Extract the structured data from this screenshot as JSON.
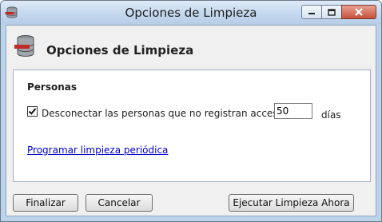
{
  "window": {
    "title": "Opciones de Limpieza"
  },
  "header": {
    "title": "Opciones de Limpieza",
    "icon": "database-cleanup-icon"
  },
  "section": {
    "title": "Personas",
    "checkbox_label": "Desconectar las personas que no registran acceso:",
    "checkbox_checked": true,
    "days_value": "50",
    "days_unit": "días",
    "link_label": "Programar limpieza periódica"
  },
  "buttons": {
    "finish": "Finalizar",
    "cancel": "Cancelar",
    "run_now": "Ejecutar Limpieza Ahora"
  },
  "colors": {
    "accent_red": "#c22a2a",
    "link": "#0000cc"
  }
}
